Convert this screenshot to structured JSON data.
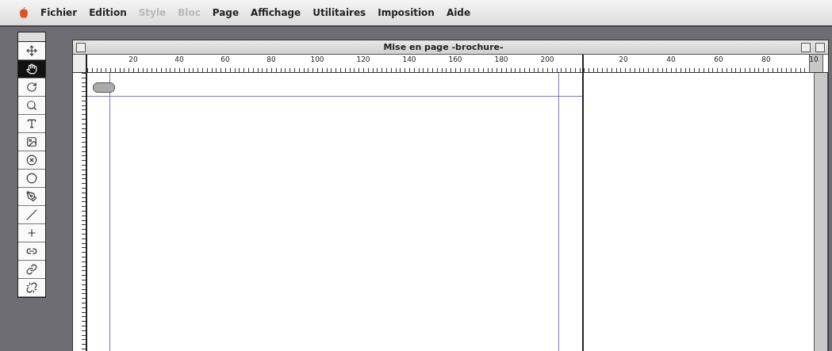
{
  "menu_bar": {
    "items": [
      {
        "label": "Fichier",
        "disabled": false
      },
      {
        "label": "Edition",
        "disabled": false
      },
      {
        "label": "Style",
        "disabled": true
      },
      {
        "label": "Bloc",
        "disabled": true
      },
      {
        "label": "Page",
        "disabled": false
      },
      {
        "label": "Affichage",
        "disabled": false
      },
      {
        "label": "Utilitaires",
        "disabled": false
      },
      {
        "label": "Imposition",
        "disabled": false
      },
      {
        "label": "Aide",
        "disabled": false
      }
    ]
  },
  "toolbox": {
    "tools": [
      {
        "selected": false
      },
      {
        "selected": true
      },
      {
        "selected": false
      },
      {
        "selected": false
      },
      {
        "selected": false
      },
      {
        "selected": false
      },
      {
        "selected": false
      },
      {
        "selected": false
      },
      {
        "selected": false
      },
      {
        "selected": false
      },
      {
        "selected": false
      },
      {
        "selected": false
      },
      {
        "selected": false
      },
      {
        "selected": false
      }
    ]
  },
  "window": {
    "title": "Mise en page -brochure-",
    "ruler_page": [
      "20",
      "40",
      "60",
      "80",
      "100",
      "120",
      "140",
      "160",
      "180",
      "200"
    ],
    "ruler_pasteboard": [
      "20",
      "40",
      "60",
      "80",
      "10"
    ]
  }
}
